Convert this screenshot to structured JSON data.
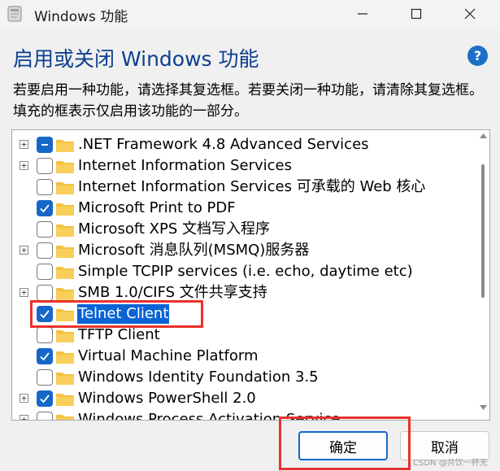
{
  "window": {
    "title": "Windows 功能",
    "app_icon": "windows-features-icon",
    "controls": [
      "minimize-icon",
      "maximize-icon",
      "close-icon"
    ]
  },
  "header": {
    "heading": "启用或关闭 Windows 功能",
    "help_icon": "?"
  },
  "description": "若要启用一种功能，请选择其复选框。若要关闭一种功能，请清除其复选框。填充的框表示仅启用该功能的一部分。",
  "features": [
    {
      "label": ".NET Framework 4.8 Advanced Services",
      "state": "partial",
      "expandable": true,
      "selected": false
    },
    {
      "label": "Internet Information Services",
      "state": "unchecked",
      "expandable": true,
      "selected": false
    },
    {
      "label": "Internet Information Services 可承载的 Web 核心",
      "state": "unchecked",
      "expandable": false,
      "selected": false
    },
    {
      "label": "Microsoft Print to PDF",
      "state": "checked",
      "expandable": false,
      "selected": false
    },
    {
      "label": "Microsoft XPS 文档写入程序",
      "state": "unchecked",
      "expandable": false,
      "selected": false
    },
    {
      "label": "Microsoft 消息队列(MSMQ)服务器",
      "state": "unchecked",
      "expandable": true,
      "selected": false
    },
    {
      "label": "Simple TCPIP services (i.e. echo, daytime etc)",
      "state": "unchecked",
      "expandable": false,
      "selected": false
    },
    {
      "label": "SMB 1.0/CIFS 文件共享支持",
      "state": "unchecked",
      "expandable": true,
      "selected": false
    },
    {
      "label": "Telnet Client",
      "state": "checked",
      "expandable": false,
      "selected": true
    },
    {
      "label": "TFTP Client",
      "state": "unchecked",
      "expandable": false,
      "selected": false
    },
    {
      "label": "Virtual Machine Platform",
      "state": "checked",
      "expandable": false,
      "selected": false
    },
    {
      "label": "Windows Identity Foundation 3.5",
      "state": "unchecked",
      "expandable": false,
      "selected": false
    },
    {
      "label": "Windows PowerShell 2.0",
      "state": "checked",
      "expandable": true,
      "selected": false
    },
    {
      "label": "Windows Process Activation Service",
      "state": "unchecked",
      "expandable": true,
      "selected": false
    }
  ],
  "buttons": {
    "ok": "确定",
    "cancel": "取消"
  },
  "watermark": "CSDN @共饮一杯无",
  "colors": {
    "accent": "#1667c8",
    "heading": "#0d3f8f",
    "selection": "#0a64d6",
    "annotation": "#e8322b",
    "folder": "#f5c142"
  }
}
